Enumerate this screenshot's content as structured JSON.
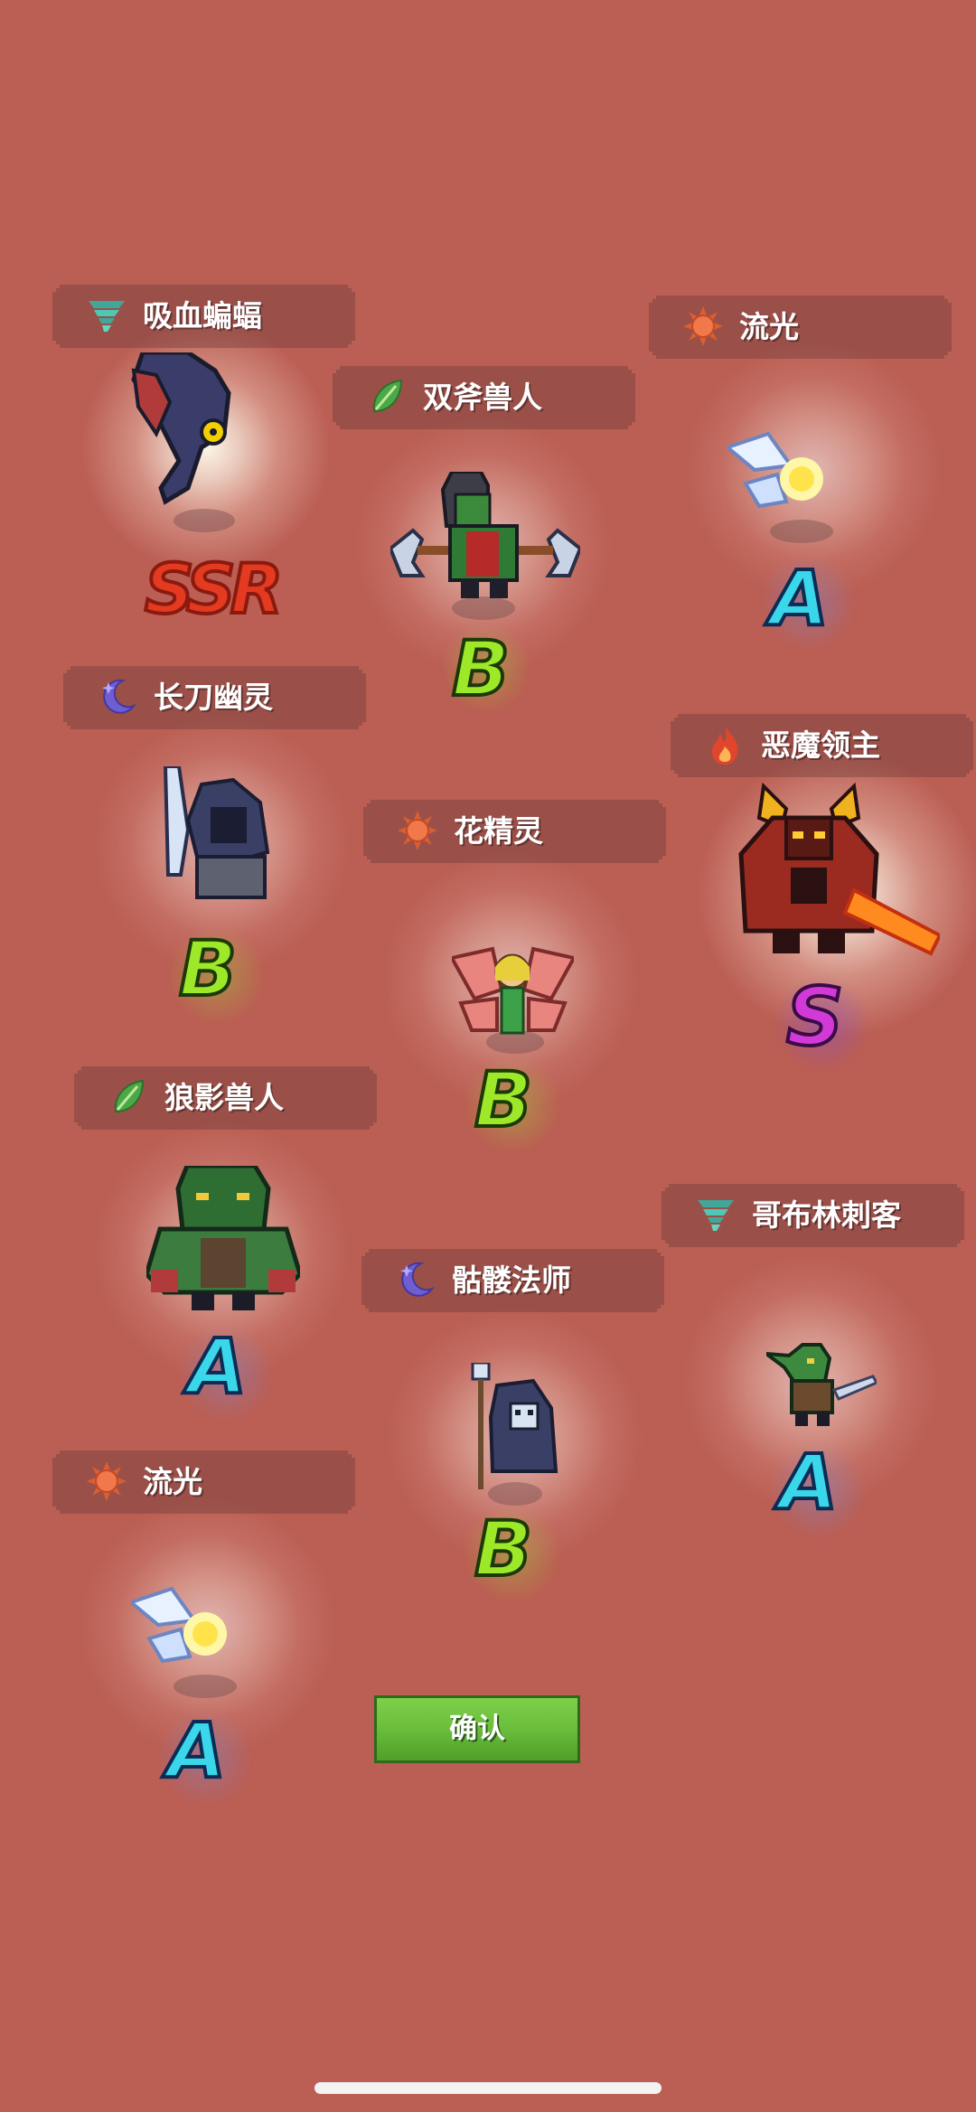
{
  "cards": [
    {
      "id": "vampire-bat",
      "name": "吸血蝙蝠",
      "element": "wind",
      "rank": "SSR",
      "rank_color": "#e33a20"
    },
    {
      "id": "twin-axe-orc",
      "name": "双斧兽人",
      "element": "leaf",
      "rank": "B",
      "rank_color": "#9ee82a"
    },
    {
      "id": "streamer-1",
      "name": "流光",
      "element": "sun",
      "rank": "A",
      "rank_color": "#3ad7ea"
    },
    {
      "id": "long-blade-ghost",
      "name": "长刀幽灵",
      "element": "moon",
      "rank": "B",
      "rank_color": "#9ee82a"
    },
    {
      "id": "flower-spirit",
      "name": "花精灵",
      "element": "sun",
      "rank": "B",
      "rank_color": "#9ee82a"
    },
    {
      "id": "demon-lord",
      "name": "恶魔领主",
      "element": "fire",
      "rank": "S",
      "rank_color": "#d23ad8"
    },
    {
      "id": "wolf-shadow-orc",
      "name": "狼影兽人",
      "element": "leaf",
      "rank": "A",
      "rank_color": "#3ad7ea"
    },
    {
      "id": "goblin-assassin",
      "name": "哥布林刺客",
      "element": "wind",
      "rank": "A",
      "rank_color": "#3ad7ea"
    },
    {
      "id": "skeleton-mage",
      "name": "骷髅法师",
      "element": "moon",
      "rank": "B",
      "rank_color": "#9ee82a"
    },
    {
      "id": "streamer-2",
      "name": "流光",
      "element": "sun",
      "rank": "A",
      "rank_color": "#3ad7ea"
    }
  ],
  "confirm_label": "确认",
  "colors": {
    "background": "#bb5e53",
    "confirm": "#6cc03c"
  }
}
